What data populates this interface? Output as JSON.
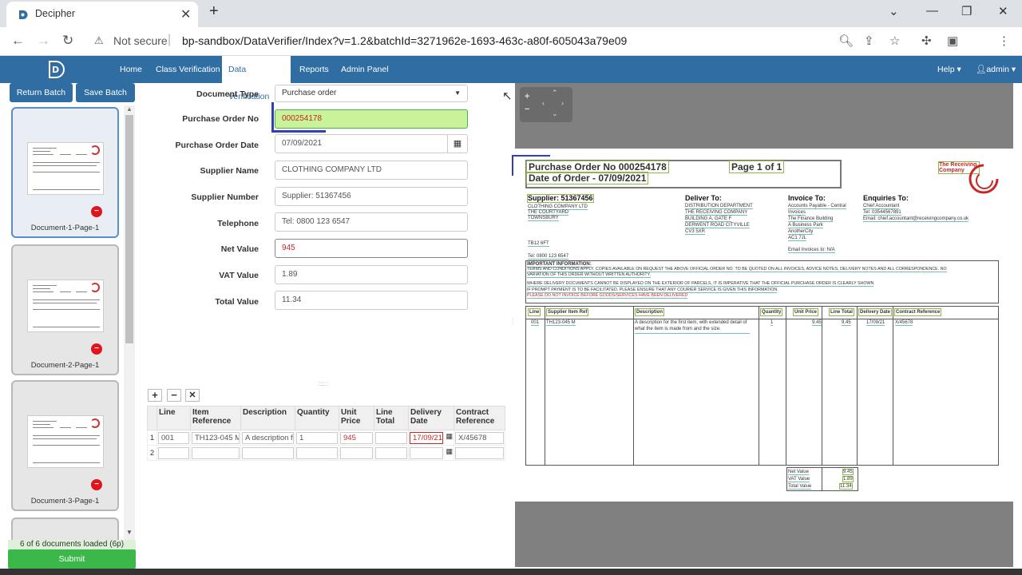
{
  "browser": {
    "tab_title": "Decipher",
    "security_label": "Not secure",
    "url": "bp-sandbox/DataVerifier/Index?v=1.2&batchId=3271962e-1693-463c-a80f-605043a79e09"
  },
  "nav": {
    "items": [
      "Home",
      "Class Verification",
      "Data Verification",
      "Reports",
      "Admin Panel"
    ],
    "active": "Data Verification",
    "help": "Help ▾",
    "user": "admin ▾"
  },
  "sidebar": {
    "return_label": "Return Batch",
    "save_label": "Save Batch",
    "documents": [
      {
        "label": "Document-1-Page-1",
        "selected": true
      },
      {
        "label": "Document-2-Page-1",
        "selected": false
      },
      {
        "label": "Document-3-Page-1",
        "selected": false
      }
    ],
    "status": "6 of 6 documents loaded (6p)",
    "submit_label": "Submit"
  },
  "form": {
    "fields": [
      {
        "label": "Document Type",
        "value": "Purchase order"
      },
      {
        "label": "Purchase Order No",
        "value": "000254178"
      },
      {
        "label": "Purchase Order Date",
        "value": "07/09/2021"
      },
      {
        "label": "Supplier Name",
        "value": "CLOTHING COMPANY LTD"
      },
      {
        "label": "Supplier Number",
        "value": "Supplier: 51367456"
      },
      {
        "label": "Telephone",
        "value": "Tel: 0800 123 6547"
      },
      {
        "label": "Net Value",
        "value": "945"
      },
      {
        "label": "VAT Value",
        "value": "1.89"
      },
      {
        "label": "Total Value",
        "value": "11.34"
      }
    ]
  },
  "grid": {
    "headers": [
      "Line",
      "Item Reference",
      "Description",
      "Quantity",
      "Unit Price",
      "Line Total",
      "Delivery Date",
      "Contract Reference"
    ],
    "rows": [
      {
        "num": "1",
        "cells": [
          "001",
          "TH123-045 M",
          "A description fo",
          "1",
          "945",
          "",
          "17/09/21",
          "X/45678"
        ]
      },
      {
        "num": "2",
        "cells": [
          "",
          "",
          "",
          "",
          "",
          "",
          "",
          ""
        ]
      }
    ]
  },
  "document": {
    "po_title": "Purchase Order No 000254178",
    "page_text": "Page 1 of 1",
    "date_text": "Date of Order - 07/09/2021",
    "company": "The Receiving Company",
    "supplier_hdr": "Supplier: 51367456",
    "supplier_lines": [
      "CLOTHING COMPANY LTD",
      "THE COURTYARD",
      "TOWNSBURY"
    ],
    "postcode": "TB12 6FT",
    "tel": "Tel: 0800 123 6547",
    "deliver_hdr": "Deliver To:",
    "deliver_lines": [
      "DISTRIBUTION DEPARTMENT",
      "THE RECEIVING COMPANY",
      "BUILDING A, GATE F",
      "DERWENT ROAD CITYVILLE",
      "CV3 5XR"
    ],
    "invoice_hdr": "Invoice To:",
    "invoice_lines": [
      "Accounts Payable - Central",
      "Invoices",
      "The Finance Building",
      "A Business Park",
      "AnotherCity",
      "AC1 7JL"
    ],
    "email_invoices": "Email Invoices to: N/A",
    "enquiries_hdr": "Enquiries To:",
    "enquiries_lines": [
      "Chief Accountant",
      "Tel: 03544567891",
      "Email: chief.accountant@receivingcompany.co.uk"
    ],
    "important_hdr": "IMPORTANT INFORMATION:",
    "important_lines": [
      "TERMS AND CONDITIONS APPLY. COPIES AVAILABLE ON REQUEST THE ABOVE OFFICIAL ORDER NO. TO BE QUOTED ON ALL INVOICES, ADVICE NOTES, DELIVERY NOTES AND ALL CORRESPONDENCE. NO",
      "VARIATION OF THIS ORDER WITHOUT WRITTEN AUTHORITY.",
      "WHERE DELIVERY DOCUMENTS CANNOT BE DISPLAYED ON THE EXTERIOR OF PARCELS, IT IS IMPERATIVE THAT THE OFFICIAL PURCHASE ORDER IS CLEARLY SHOWN",
      "IF PROMPT PAYMENT IS TO BE FACILITATED. PLEASE ENSURE THAT ANY COURIER SERVICE IS GIVEN THIS INFORMATION",
      "PLEASE DO NOT INVOICE BEFORE GOODS/SERVICES HAVE BEEN DELIVERED"
    ],
    "table_headers": [
      "Line",
      "Supplier Item Ref",
      "Description",
      "Quantity",
      "Unit Price",
      "Line Total",
      "Delivery Date",
      "Contract Reference"
    ],
    "table_row": [
      "001",
      "TH123-045 M",
      "A description for the first item, with extended detail of what the item is made from and the size.",
      "1",
      "9.45",
      "9.45",
      "17/09/21",
      "X/45678"
    ],
    "totals": [
      {
        "label": "Net Value",
        "value": "9.45"
      },
      {
        "label": "VAT Value",
        "value": "1.89"
      },
      {
        "label": "Total Value",
        "value": "11.34"
      }
    ]
  }
}
